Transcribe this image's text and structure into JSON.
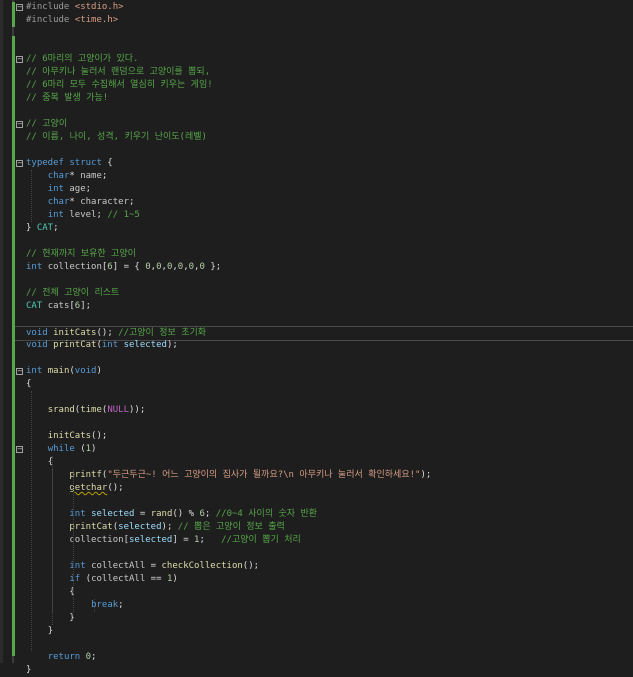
{
  "editor": {
    "lines": [
      {
        "text": "#include <stdio.h>",
        "fold": "minus"
      },
      {
        "text": "#include <time.h>"
      },
      {
        "text": ""
      },
      {
        "text": ""
      },
      {
        "text": "// 6마리의 고양이가 있다.",
        "fold": "minus"
      },
      {
        "text": "// 아무키나 눌러서 랜덤으로 고양이를 뽑되,"
      },
      {
        "text": "// 6마리 모두 수집해서 열심히 키우는 게임!"
      },
      {
        "text": "// 중복 발생 가능!"
      },
      {
        "text": ""
      },
      {
        "text": "// 고양이",
        "fold": "minus"
      },
      {
        "text": "// 이름, 나이, 성격, 키우기 난이도(레벨)"
      },
      {
        "text": ""
      },
      {
        "text": "typedef struct {",
        "fold": "minus"
      },
      {
        "text": "    char* name;"
      },
      {
        "text": "    int age;"
      },
      {
        "text": "    char* character;"
      },
      {
        "text": "    int level; // 1~5"
      },
      {
        "text": "} CAT;"
      },
      {
        "text": ""
      },
      {
        "text": "// 현재까지 보유한 고양이"
      },
      {
        "text": "int collection[6] = { 0,0,0,0,0,0 };"
      },
      {
        "text": ""
      },
      {
        "text": "// 전체 고양이 리스트"
      },
      {
        "text": "CAT cats[6];"
      },
      {
        "text": ""
      },
      {
        "text": "void initCats(); //고양이 정보 초기화",
        "current": true
      },
      {
        "text": "void printCat(int selected);"
      },
      {
        "text": ""
      },
      {
        "text": "int main(void)",
        "fold": "minus"
      },
      {
        "text": "{"
      },
      {
        "text": ""
      },
      {
        "text": "    srand(time(NULL));"
      },
      {
        "text": ""
      },
      {
        "text": "    initCats();"
      },
      {
        "text": "    while (1)",
        "fold": "minus"
      },
      {
        "text": "    {"
      },
      {
        "text": "        printf(\"두근두근~! 어느 고양이의 집사가 될까요?\\n 아무키나 눌러서 확인하세요!\");"
      },
      {
        "text": "        getchar();"
      },
      {
        "text": ""
      },
      {
        "text": "        int selected = rand() % 6; //0~4 사이의 숫자 반환"
      },
      {
        "text": "        printCat(selected); // 뽑은 고양이 정보 출력"
      },
      {
        "text": "        collection[selected] = 1;   //고양이 뽑기 처리"
      },
      {
        "text": ""
      },
      {
        "text": "        int collectAll = checkCollection();"
      },
      {
        "text": "        if (collectAll == 1)"
      },
      {
        "text": "        {"
      },
      {
        "text": "            break;"
      },
      {
        "text": "        }"
      },
      {
        "text": "    }"
      },
      {
        "text": ""
      },
      {
        "text": "    return 0;"
      },
      {
        "text": "}"
      }
    ]
  },
  "colors": {
    "background": "#1e1e1e",
    "keyword": "#569cd6",
    "comment": "#57a64a",
    "string": "#d69d85",
    "number": "#b5cea8",
    "function": "#dcdcaa",
    "change_bar": "#57a64a"
  },
  "icons": {
    "fold_collapse": "minus-box-icon"
  }
}
